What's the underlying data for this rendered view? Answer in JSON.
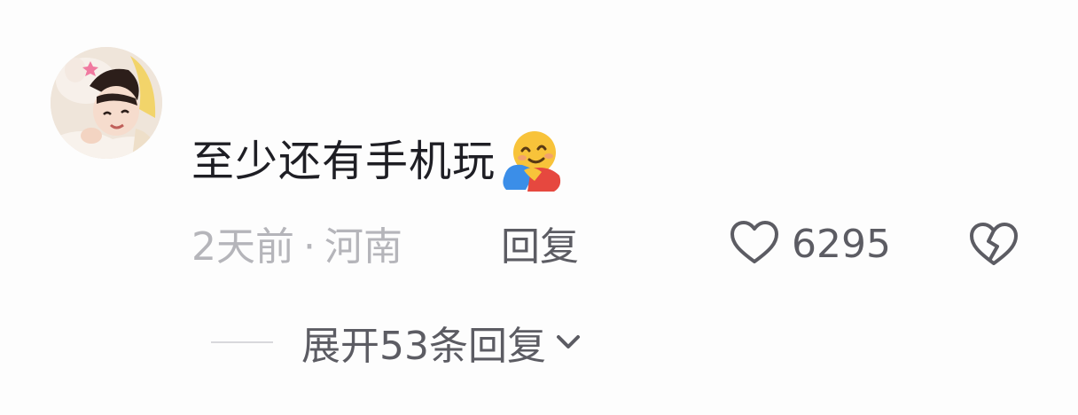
{
  "comment": {
    "avatar_icon": "user-avatar-photo",
    "text": "至少还有手机玩",
    "emoji_icon": "hugging-face-emoji",
    "time": "2天前",
    "separator": "·",
    "location": "河南",
    "reply_label": "回复",
    "likes": "6295",
    "like_icon": "heart-outline-icon",
    "dislike_icon": "broken-heart-icon"
  },
  "replies": {
    "expand_label": "展开53条回复",
    "expand_icon": "chevron-down-icon"
  },
  "colors": {
    "text_primary": "#1e1e24",
    "text_meta": "#b5b5ba",
    "text_secondary": "#5c5c63",
    "background": "#fdfdfd"
  }
}
